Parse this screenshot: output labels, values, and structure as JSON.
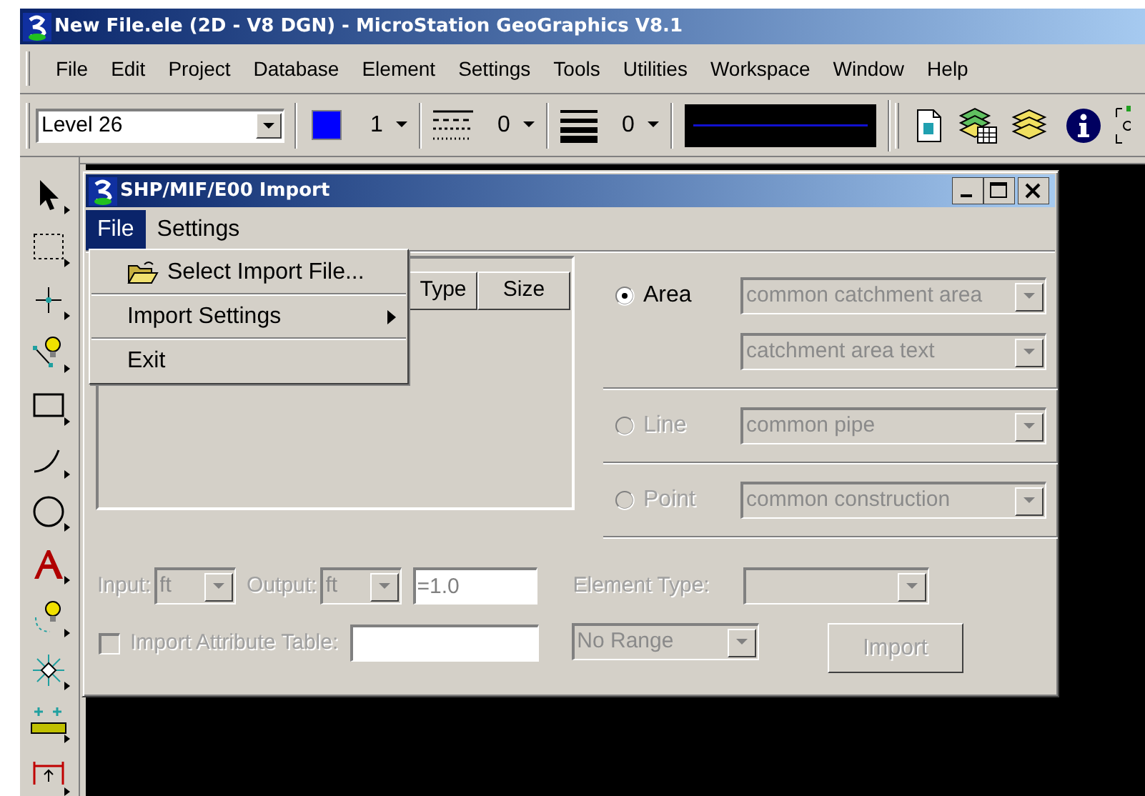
{
  "window": {
    "title": "New File.ele (2D - V8 DGN) - MicroStation GeoGraphics V8.1"
  },
  "menu_bar": [
    "File",
    "Edit",
    "Project",
    "Database",
    "Element",
    "Settings",
    "Tools",
    "Utilities",
    "Workspace",
    "Window",
    "Help"
  ],
  "attributes_toolbar": {
    "level": "Level 26",
    "color_number": "1",
    "style": "0",
    "weight": "0"
  },
  "dialog": {
    "title": "SHP/MIF/E00 Import",
    "menu_bar": [
      {
        "label": "File",
        "selected": true
      },
      {
        "label": "Settings",
        "selected": false
      }
    ],
    "file_menu": [
      {
        "label": "Select Import File...",
        "kind": "folder"
      },
      {
        "label": "Import Settings",
        "kind": "submenu"
      },
      {
        "label": "Exit",
        "kind": "plain"
      }
    ],
    "file_list": {
      "columns": [
        "Type",
        "Size"
      ]
    },
    "feature_types": [
      {
        "label": "Area",
        "selected": true,
        "disabled": false,
        "dropdowns": [
          "common catchment area",
          "catchment area text"
        ]
      },
      {
        "label": "Line",
        "selected": false,
        "disabled": true,
        "dropdowns": [
          "common pipe"
        ]
      },
      {
        "label": "Point",
        "selected": false,
        "disabled": true,
        "dropdowns": [
          "common construction"
        ]
      }
    ],
    "units": {
      "input_label": "Input:",
      "input_value": "ft",
      "output_label": "Output:",
      "output_value": "ft",
      "scale": "=1.0",
      "disabled": true
    },
    "element_type": {
      "label": "Element Type:",
      "disabled": true
    },
    "import_attribute_table": {
      "label": "Import Attribute Table:",
      "checked": false,
      "disabled": true
    },
    "range": "No Range",
    "import_button": {
      "label": "Import",
      "disabled": true
    }
  }
}
